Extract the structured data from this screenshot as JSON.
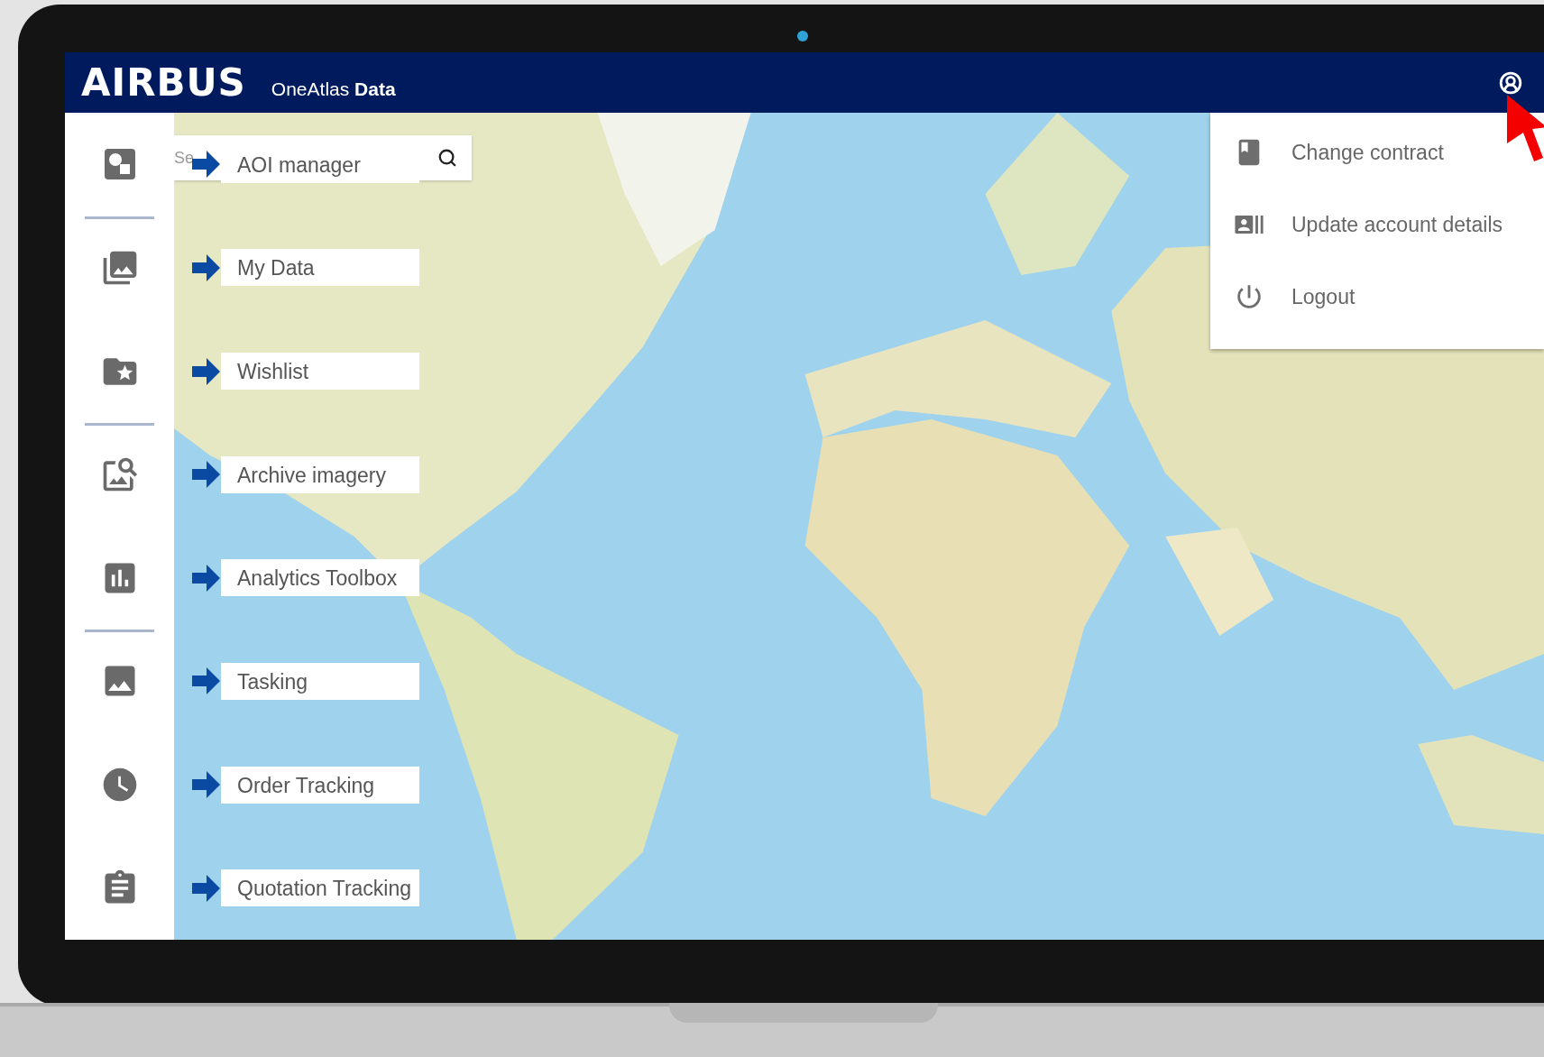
{
  "header": {
    "logo": "AIRBUS",
    "product": "OneAtlas",
    "product_bold": "Data"
  },
  "search": {
    "placeholder": "Se"
  },
  "annotations": [
    {
      "label": "AOI manager"
    },
    {
      "label": "My Data"
    },
    {
      "label": "Wishlist"
    },
    {
      "label": "Archive imagery"
    },
    {
      "label": "Analytics Toolbox"
    },
    {
      "label": "Tasking"
    },
    {
      "label": "Order Tracking"
    },
    {
      "label": "Quotation Tracking"
    }
  ],
  "account_menu": {
    "items": [
      {
        "label": "Change contract"
      },
      {
        "label": "Update account details"
      },
      {
        "label": "Logout"
      }
    ]
  }
}
